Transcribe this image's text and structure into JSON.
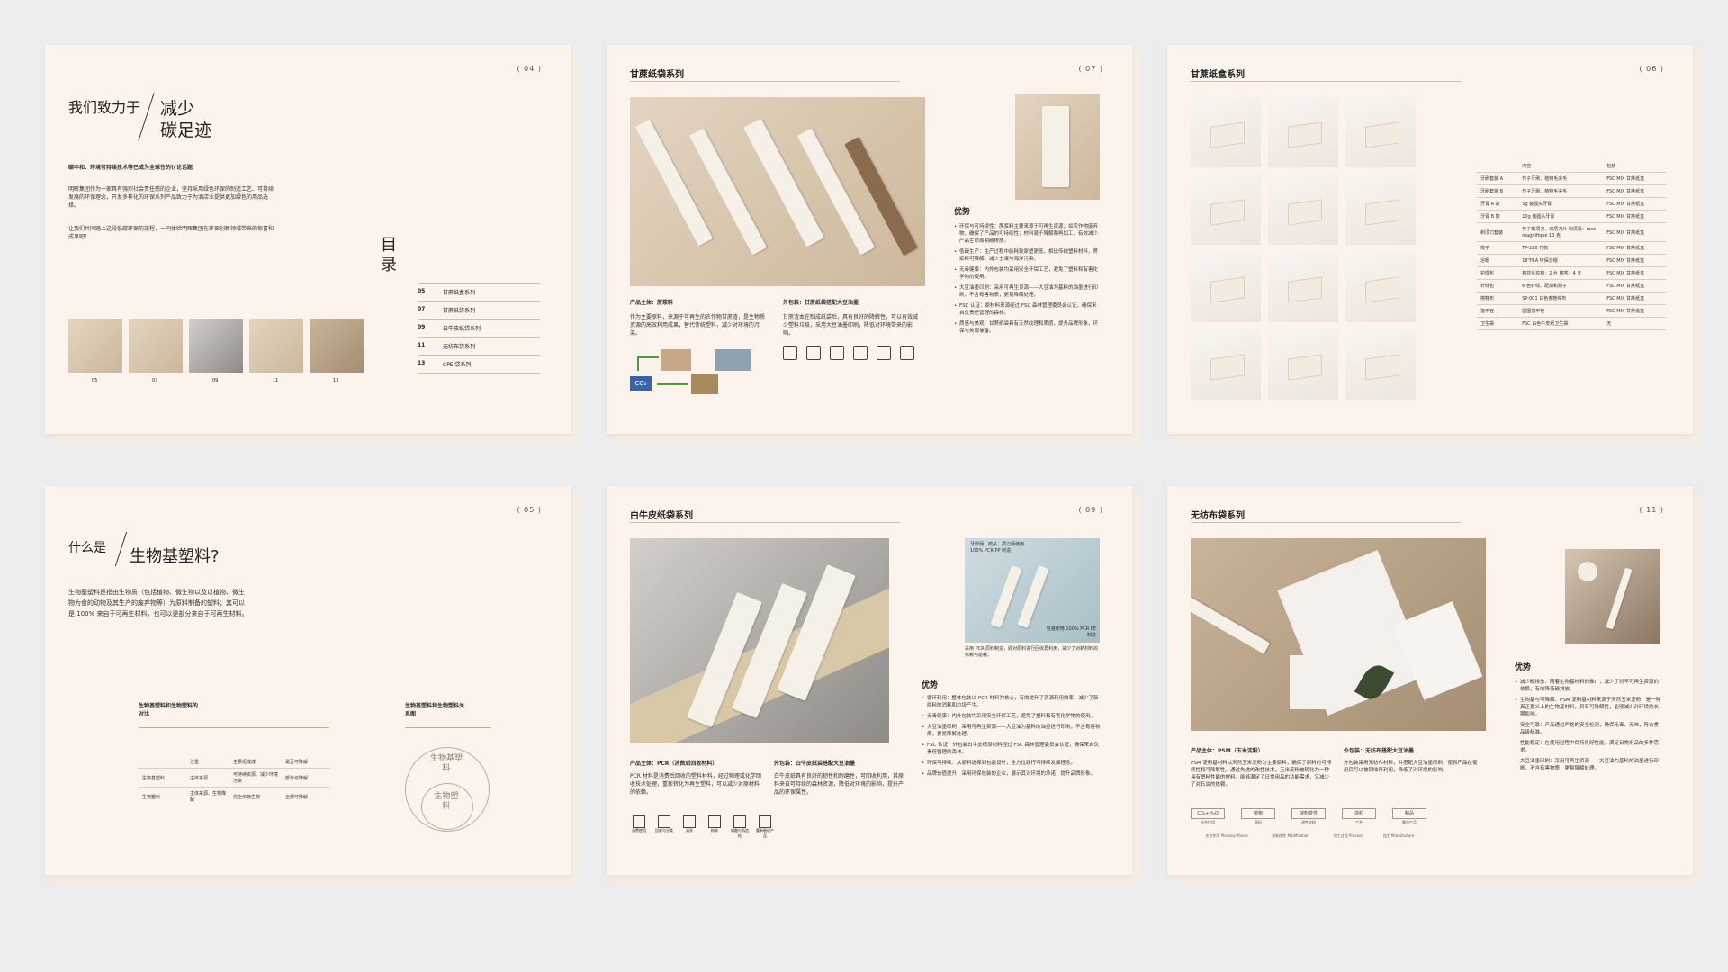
{
  "spreads": {
    "p04": {
      "page_num": "( 04 )",
      "heading_left": "我们致力于",
      "heading_right_1": "减少",
      "heading_right_2": "碳足迹",
      "intro_bold": "碳中和、环境可持续技术等已成为全球性的讨论话题",
      "para1": "明晖集团作为一家具有强烈社会责任感的企业，坚持采用绿色环保的制造工艺、可持续发展的环保理念，开发多样化的环保系列产品致力于为酒店业提供更加绿色的用品选择。",
      "para2": "让我们共同踏上这段低碳环保的旅程，一同体验明晖集团在环保创新领域带来的惊喜和成果吧！",
      "toc_title": "目录",
      "toc": [
        {
          "num": "05",
          "label": "甘蔗纸盒系列"
        },
        {
          "num": "07",
          "label": "甘蔗纸袋系列"
        },
        {
          "num": "09",
          "label": "白牛皮纸袋系列"
        },
        {
          "num": "11",
          "label": "无纺布袋系列"
        },
        {
          "num": "13",
          "label": "CPE 袋系列"
        }
      ],
      "thumbs": [
        "05",
        "07",
        "09",
        "11",
        "13"
      ]
    },
    "p07": {
      "page_num": "( 07 )",
      "title": "甘蔗纸袋系列",
      "advantage": "优势",
      "cap_left": "产品主体：蔗浆料",
      "cap_right": "外包装：甘蔗纸袋搭配大豆油墨",
      "text_left": "作为主要原料，来源于可再生的农作物甘蔗渣，是生物质资源的高效利用成果，替代传统塑料，减少对环境的污染。",
      "text_right": "甘蔗渣本在制成纸袋后，具有良好的降解性，可以有效减少塑料垃圾，采用大豆油墨印刷，降低对环境带来的影响。",
      "co2": "CO₂",
      "bullets": [
        "环保与可持续性：蔗浆料主要来源于可再生资源，如农作物废弃物，确保了产品的可持续性；材料易于降解和再加工，有效减少产品生命周期碳排放。",
        "低碳生产：生产过程中能耗较原塑更低，相比传统塑料材料，蔗浆料可降解，减少土壤与海洋污染。",
        "无毒健康：内外包装均采用安全环保工艺，避免了塑料和有害化学物的使用。",
        "大豆油墨印刷：采用可再生资源——大豆油为基料的油墨进行印刷，不含有害物质，更易降解处理。",
        "FSC 认证：原材料来源经过 FSC 森林管理委员会认证，确保来自负责任管理的森林。",
        "质感与美观：甘蔗纸袋具有天然纹理和质感，提升品牌形象，环保与美观兼备。"
      ]
    },
    "p06": {
      "page_num": "( 06 )",
      "title": "甘蔗纸盒系列",
      "table_head": [
        "",
        "内容",
        "包装"
      ],
      "table_rows": [
        [
          "牙刷套装 A",
          "竹子牙刷、植物毛尖毛",
          "FSC MIX 甘蔗纸盒"
        ],
        [
          "牙刷套装 B",
          "竹子牙刷、植物毛尖毛",
          "FSC MIX 甘蔗纸盒"
        ],
        [
          "牙膏 A 款",
          "5g 装圆头牙膏",
          "FSC MIX 甘蔗纸盒"
        ],
        [
          "牙膏 B 款",
          "10g 装圆头牙膏",
          "FSC MIX 甘蔗纸盒"
        ],
        [
          "剃须刀套装",
          "竹子剃须刀、双层刀片 剃须膏：rose magnifique 10 克",
          "FSC MIX 甘蔗纸盒"
        ],
        [
          "梳子",
          "TP-228 竹梳",
          "FSC MIX 甘蔗纸盒"
        ],
        [
          "浴帽",
          "18\"PLA 环保浴帽",
          "FSC MIX 甘蔗纸盒"
        ],
        [
          "护理包",
          "棉花化妆棉：2 片 棉签：4 支",
          "FSC MIX 甘蔗纸盒"
        ],
        [
          "针线包",
          "6 色针线、配扣和别子",
          "FSC MIX 甘蔗纸盒"
        ],
        [
          "擦鞋布",
          "SP-001 白色擦鞋绵布",
          "FSC MIX 甘蔗纸盒"
        ],
        [
          "指甲锉",
          "圆圈指甲锉",
          "FSC MIX 甘蔗纸盒"
        ],
        [
          "卫生袋",
          "FSC 白色牛皮纸卫生袋",
          "无"
        ]
      ]
    },
    "p05": {
      "page_num": "( 05 )",
      "q_left": "什么是",
      "q_right": "生物基塑料?",
      "para": "生物基塑料是指由生物质（包括植物、微生物以及以植物、微生物为食的动物及其生产的废弃物等）为原料制备的塑料；其可以是 100% 来自于可再生材料，也可以是部分来自于可再生材料。",
      "sec_left": "生物基塑料和生物塑料的对比",
      "sec_right": "生物基塑料和生物塑料关系图",
      "compare_head": [
        "",
        "注重",
        "主要组成成",
        "是否可降解"
      ],
      "compare_rows": [
        [
          "生物基塑料",
          "主体来源",
          "可持续资源、减少环境污染",
          "部分可降解"
        ],
        [
          "生物塑料",
          "主体来源、生物降解",
          "完全依赖生物",
          "全部可降解"
        ]
      ],
      "circle_outer": "生物基塑料",
      "circle_inner": "生物塑料"
    },
    "p09": {
      "page_num": "( 09 )",
      "title": "白牛皮纸袋系列",
      "advantage": "优势",
      "photo_label_top": "牙刷柄、梳子、须刀柄使用 100% PCR PP 制造",
      "photo_label_bottom": "包装使用 100% PCR PE 制造",
      "photo_caption": "采用 PCR 原料制造，即对原料进行回收再利用，减少了对新材料的依赖与能耗。",
      "cap_left": "产品主体：PCR（消费后回收材料）",
      "cap_right": "外包装：白牛皮纸袋搭配大豆油墨",
      "text_left": "PCR 材料是消费后回收的塑料材料，经过物理或化学回收技术处理，重新转化为再生塑料，可以减少对原材料的依赖。",
      "text_right": "白牛皮纸具有良好的韧性和耐磨性，可回收利用，其原料来自可持续的森林资源，降低对环境的影响，提升产品的环保属性。",
      "icon_labels": [
        "消费使用",
        "回收与分类",
        "清洗",
        "粉碎",
        "熔融与再造粒",
        "重新制成产品"
      ],
      "bullets": [
        "循环利用：整体包装以 PCR 材料为核心，有效提升了资源利用效率，减少了新原料的消耗和垃圾产生。",
        "无毒健康：内外包装均采用安全环保工艺，避免了塑料和有害化学物的使用。",
        "大豆油墨印刷：采用可再生资源——大豆油为基料的油墨进行印刷，不含有害物质，更易降解处理。",
        "FSC 认证：外包装白牛皮纸原材料经过 FSC 森林管理委员会认证，确保来自负责任管理的森林。",
        "环保可持续：从原料选择到包装设计，全方位践行可持续发展理念。",
        "品牌价值提升：采用环保包装的企业，展示其对环境的承诺，提升品牌形象。"
      ]
    },
    "p11": {
      "page_num": "( 11 )",
      "title": "无纺布袋系列",
      "advantage": "优势",
      "cap_left": "产品主体：PSM（玉米淀粉）",
      "cap_right": "外包装：无纺布搭配大豆油墨",
      "text_left": "PSM 淀粉基材料以天然玉米淀粉为主要原料，确保了原料的可持续性和可降解性。通过先进的改性技术，玉米淀粉被转化为一种具有塑料性能的材料，能够满足了日常用品的功能需求，又减少了对石油的依赖。",
      "text_right": "外包装采用无纺布材料，并搭配大豆油墨印刷，使得产品在使用后可以被回收再利用，降低了对环境的影响。",
      "flow": [
        "CO₂+H₂O",
        "植物",
        "淀粉变性",
        "造粒",
        "制品"
      ],
      "flow_sub": [
        "光合作用",
        "原料",
        "改性淀粉",
        "工艺",
        "最终产品"
      ],
      "flow_bottom": [
        "光合作用 Photosynthesis",
        "淀粉改性 Modification",
        "加工过程 Process",
        "加工 Manufacture"
      ],
      "bullets": [
        "减少碳排放：随着生物基材料的推广，减少了对不可再生资源的依赖，有效降低碳排放。",
        "生物基与可降解：PSM 淀粉基材料来源于天然玉米淀粉，是一种真正意义上的生物基材料，具有可降解性，能够减少对环境的长期影响。",
        "安全可靠：产品通过严格的安全检测，确保无毒、无味，符合食品级标准。",
        "性能稳定：在使用过程中保持良好性能，满足日常用品的多种需求。",
        "大豆油墨印刷：采用可再生资源——大豆油为基料的油墨进行印刷，不含有害物质，更易降解处理。"
      ]
    }
  }
}
